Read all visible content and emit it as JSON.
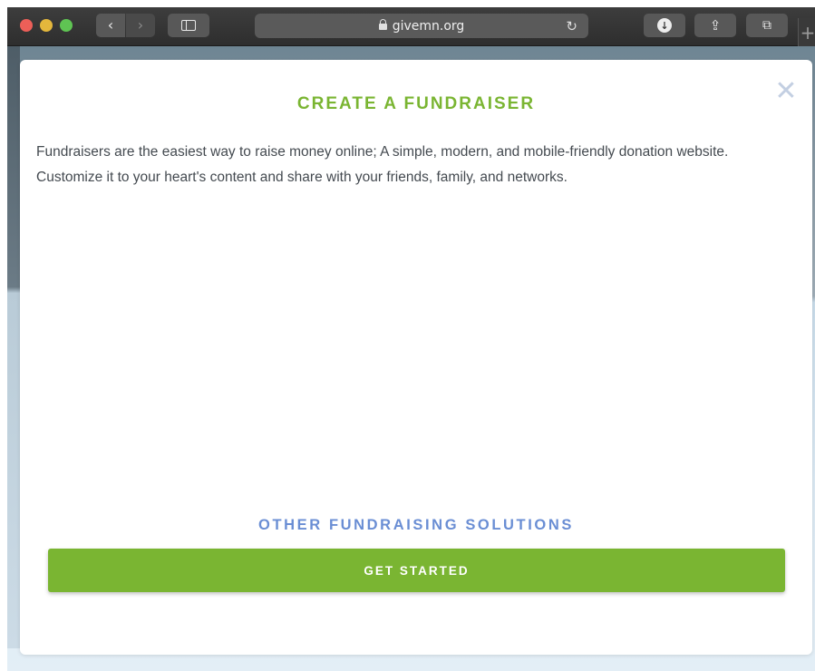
{
  "browser": {
    "url": "givemn.org",
    "back_glyph": "‹",
    "forward_glyph": "›",
    "reload_glyph": "↻",
    "share_glyph": "⇪",
    "tabs_glyph": "⧉",
    "newtab_glyph": "+",
    "download_glyph": "↓"
  },
  "modal": {
    "title": "CREATE A FUNDRAISER",
    "close_glyph": "✕",
    "description": "Fundraisers are the easiest way to raise money online; A simple, modern, and mobile-friendly donation website. Customize it to your heart's content and share with your friends, family, and networks.",
    "other_solutions_label": "OTHER FUNDRAISING SOLUTIONS",
    "get_started_label": "GET STARTED"
  },
  "colors": {
    "accent_green": "#7ab532",
    "link_blue": "#6a8ed4",
    "close_gray": "#c3cfe2"
  }
}
